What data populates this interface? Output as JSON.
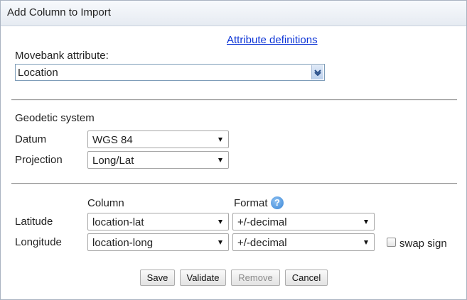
{
  "dialog": {
    "title": "Add Column to Import"
  },
  "attribute_definitions_link": "Attribute definitions",
  "movebank_attribute": {
    "label": "Movebank attribute:",
    "value": "Location"
  },
  "geodetic": {
    "heading": "Geodetic system",
    "datum_label": "Datum",
    "datum_value": "WGS 84",
    "projection_label": "Projection",
    "projection_value": "Long/Lat"
  },
  "columns": {
    "column_header": "Column",
    "format_header": "Format",
    "help_glyph": "?",
    "latitude": {
      "label": "Latitude",
      "column": "location-lat",
      "format": "+/-decimal"
    },
    "longitude": {
      "label": "Longitude",
      "column": "location-long",
      "format": "+/-decimal"
    },
    "swap_sign_label": "swap sign",
    "swap_sign_checked": false
  },
  "buttons": {
    "save": "Save",
    "validate": "Validate",
    "remove": "Remove",
    "cancel": "Cancel"
  },
  "colors": {
    "link": "#0b33d6",
    "help_icon": "#3a86d6"
  }
}
